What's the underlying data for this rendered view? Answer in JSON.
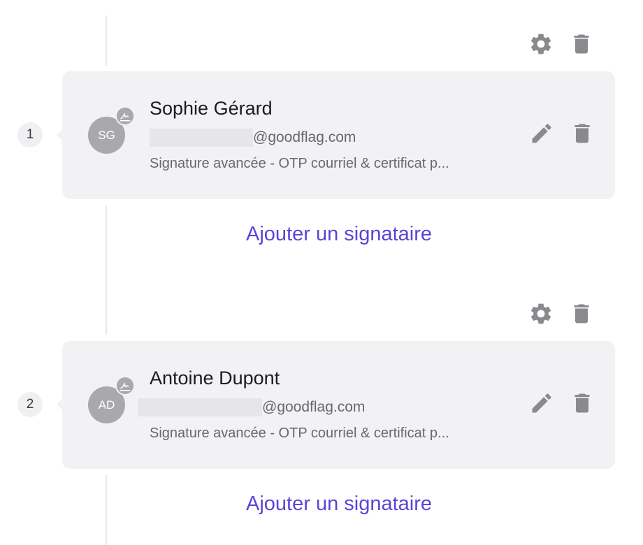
{
  "signers": [
    {
      "step": "1",
      "initials": "SG",
      "name": "Sophie Gérard",
      "email_domain": "@goodflag.com",
      "method": "Signature avancée - OTP courriel & certificat p...",
      "add_label": "Ajouter un signataire"
    },
    {
      "step": "2",
      "initials": "AD",
      "name": "Antoine Dupont",
      "email_domain": "@goodflag.com",
      "method": "Signature avancée - OTP courriel & certificat p...",
      "add_label": "Ajouter un signataire"
    }
  ],
  "icons": {
    "settings": "gear-icon",
    "delete": "trash-icon",
    "edit": "pencil-icon",
    "signature": "signature-icon"
  },
  "colors": {
    "accent": "#5b45d6",
    "icon": "#8a8a8e",
    "card": "#f2f2f4",
    "avatar": "#a9a9ac"
  }
}
